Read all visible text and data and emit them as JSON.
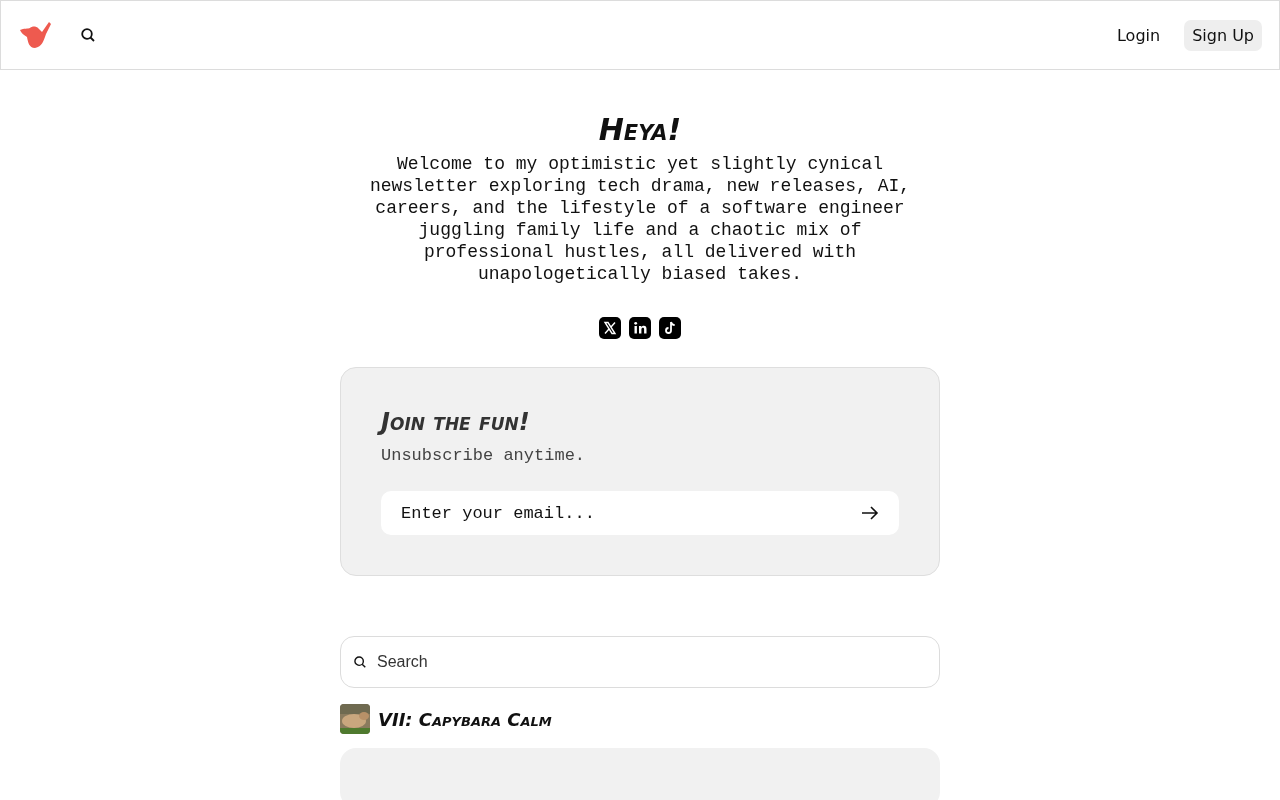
{
  "header": {
    "login": "Login",
    "signup": "Sign Up"
  },
  "hero": {
    "title": "Heya!",
    "description": "Welcome to my optimistic yet slightly cynical newsletter exploring tech drama, new releases, AI, careers, and the lifestyle of a software engineer juggling family life and a chaotic mix of professional hustles, all delivered with unapologetically biased takes."
  },
  "socials": [
    {
      "kind": "x"
    },
    {
      "kind": "linkedin"
    },
    {
      "kind": "tiktok"
    }
  ],
  "subscribe": {
    "title": "Join the fun!",
    "subtitle": "Unsubscribe anytime.",
    "placeholder": "Enter your email..."
  },
  "search": {
    "placeholder": "Search"
  },
  "posts": [
    {
      "title": "VII: Capybara Calm"
    }
  ]
}
